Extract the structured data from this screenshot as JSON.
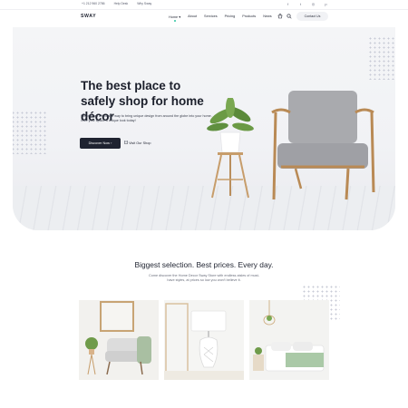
{
  "topbar": {
    "phone": "+1 212 960 2786",
    "help": "Help Desk",
    "why": "Why Sway",
    "social": [
      {
        "icon": "facebook-icon",
        "glyph": "f"
      },
      {
        "icon": "twitter-icon",
        "glyph": "t"
      },
      {
        "icon": "instagram-icon",
        "glyph": "◎"
      },
      {
        "icon": "pinterest-icon",
        "glyph": "p"
      }
    ]
  },
  "header": {
    "logo": "SWAY",
    "nav": [
      "Home",
      "About",
      "Services",
      "Pricing",
      "Products",
      "News"
    ],
    "nav_chevron": "▾",
    "contact": "Contact Us"
  },
  "hero": {
    "title": "The best place to safely shop for home décor",
    "subtitle": "We offer an affordable way to bring unique design from around the globe into your home. Give your space a unique look today!",
    "cta": "Discover Now",
    "cta_arrow": "›",
    "link": "Visit Our Shop"
  },
  "section": {
    "title": "Biggest selection. Best prices. Every day.",
    "subtitle": "Come discover the Home Decor Sway Store with endless aisles of must-have styles, at prices so low you won't believe it."
  },
  "colors": {
    "dark": "#1f2330",
    "accent": "#2cc4a1",
    "hero_bg": "#f1f2f5"
  }
}
